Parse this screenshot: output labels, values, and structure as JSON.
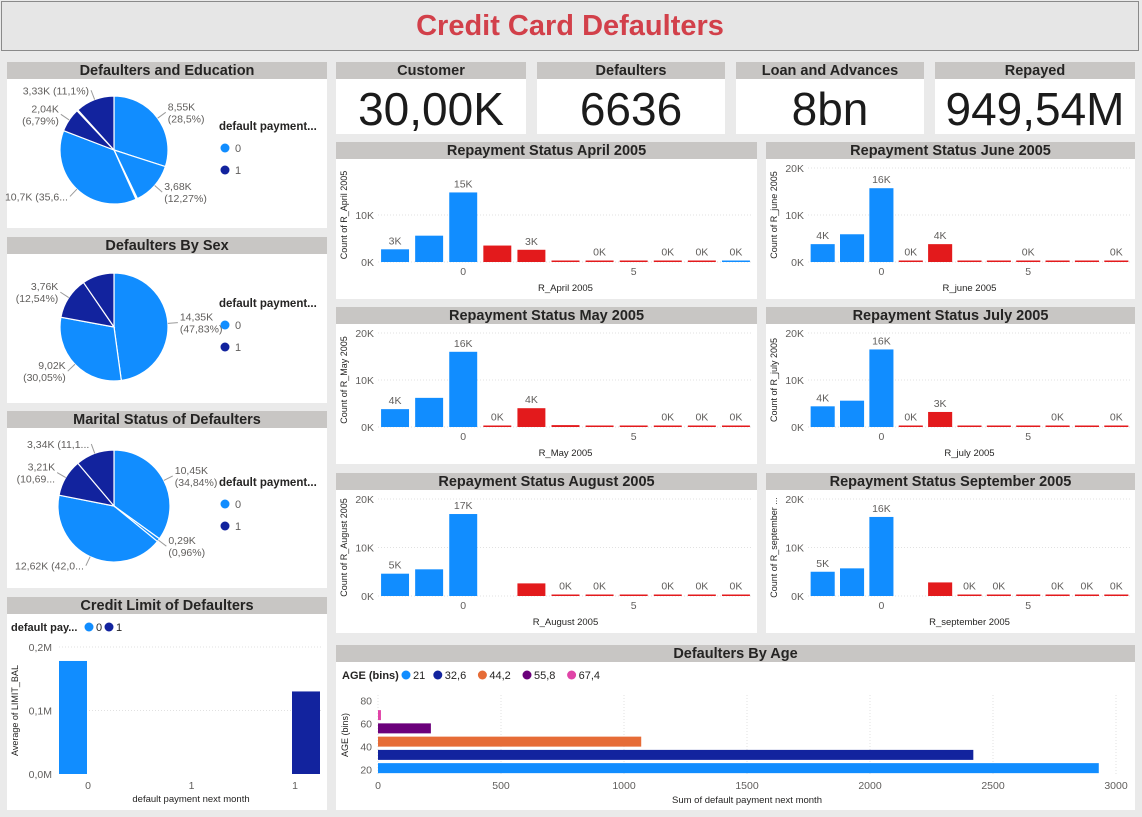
{
  "title": "Credit Card Defaulters",
  "colors": {
    "c0": "#118dff",
    "c1": "#12239e",
    "red": "#e31a1c",
    "age44": "#e66c37",
    "age55": "#6b007b",
    "age67": "#e044a7"
  },
  "kpis": [
    {
      "label": "Customer",
      "value": "30,00K"
    },
    {
      "label": "Defaulters",
      "value": "6636"
    },
    {
      "label": "Loan and Advances",
      "value": "8bn"
    },
    {
      "label": "Repayed",
      "value": "949,54M"
    }
  ],
  "legend": {
    "title": "default payment...",
    "items": [
      "0",
      "1"
    ]
  },
  "chart_data": [
    {
      "id": "education",
      "type": "pie",
      "title": "Defaulters and Education",
      "legend_title": "default payment...",
      "slices": [
        {
          "value": 8.55,
          "label": "8,55K",
          "pct": "(28,5%)",
          "color": "#118dff"
        },
        {
          "value": 3.68,
          "label": "3,68K",
          "pct": "(12,27%)",
          "color": "#118dff"
        },
        {
          "value": 0.06,
          "label": "",
          "pct": "",
          "color": "#118dff"
        },
        {
          "value": 0.07,
          "label": "",
          "pct": "",
          "color": "#118dff"
        },
        {
          "value": 10.7,
          "label": "10,7K (35,6...",
          "pct": "",
          "color": "#118dff"
        },
        {
          "value": 2.04,
          "label": "2,04K",
          "pct": "(6,79%)",
          "color": "#12239e"
        },
        {
          "value": 0.1,
          "label": "",
          "pct": "",
          "color": "#12239e"
        },
        {
          "value": 3.33,
          "label": "3,33K (11,1%)",
          "pct": "",
          "color": "#12239e"
        }
      ]
    },
    {
      "id": "sex",
      "type": "pie",
      "title": "Defaulters By Sex",
      "legend_title": "default payment...",
      "slices": [
        {
          "value": 14.35,
          "label": "14,35K",
          "pct": "(47,83%)",
          "color": "#118dff"
        },
        {
          "value": 9.02,
          "label": "9,02K",
          "pct": "(30,05%)",
          "color": "#118dff"
        },
        {
          "value": 3.76,
          "label": "3,76K",
          "pct": "(12,54%)",
          "color": "#12239e"
        },
        {
          "value": 2.87,
          "label": "",
          "pct": "",
          "color": "#12239e"
        }
      ]
    },
    {
      "id": "marital",
      "type": "pie",
      "title": "Marital Status of Defaulters",
      "legend_title": "default payment...",
      "slices": [
        {
          "value": 10.45,
          "label": "10,45K",
          "pct": "(34,84%)",
          "color": "#118dff"
        },
        {
          "value": 0.29,
          "label": "0,29K",
          "pct": "(0,96%)",
          "color": "#118dff"
        },
        {
          "value": 12.62,
          "label": "12,62K (42,0...",
          "pct": "",
          "color": "#118dff"
        },
        {
          "value": 3.21,
          "label": "3,21K",
          "pct": "(10,69...",
          "color": "#12239e"
        },
        {
          "value": 3.34,
          "label": "3,34K (11,1...",
          "pct": "",
          "color": "#12239e"
        }
      ]
    },
    {
      "id": "april",
      "type": "bar",
      "title": "Repayment Status April 2005",
      "xlabel": "R_April 2005",
      "ylabel": "Count of R_April 2005",
      "ylim": [
        0,
        20000
      ],
      "yticks": [
        "0K",
        "10K"
      ],
      "xticks": [
        0,
        5
      ],
      "values": [
        2700,
        5600,
        14800,
        3500,
        2600,
        300,
        100,
        100,
        100,
        100,
        100
      ],
      "colors": [
        "#118dff",
        "#118dff",
        "#118dff",
        "#e31a1c",
        "#e31a1c",
        "#e31a1c",
        "#e31a1c",
        "#e31a1c",
        "#e31a1c",
        "#e31a1c",
        "#118dff"
      ],
      "labels": [
        "3K",
        "",
        "15K",
        "",
        "3K",
        "",
        "0K",
        "",
        "0K",
        "0K",
        "0K"
      ]
    },
    {
      "id": "june",
      "type": "bar",
      "title": "Repayment Status June 2005",
      "xlabel": "R_june 2005",
      "ylabel": "Count of R_june 2005",
      "ylim": [
        0,
        20000
      ],
      "yticks": [
        "0K",
        "10K",
        "20K"
      ],
      "xticks": [
        0,
        5
      ],
      "values": [
        3800,
        5900,
        15700,
        100,
        3800,
        100,
        100,
        100,
        100,
        100,
        100
      ],
      "colors": [
        "#118dff",
        "#118dff",
        "#118dff",
        "#e31a1c",
        "#e31a1c",
        "#e31a1c",
        "#e31a1c",
        "#e31a1c",
        "#e31a1c",
        "#e31a1c",
        "#e31a1c"
      ],
      "labels": [
        "4K",
        "",
        "16K",
        "0K",
        "4K",
        "",
        "",
        "0K",
        "",
        "",
        "0K"
      ]
    },
    {
      "id": "may",
      "type": "bar",
      "title": "Repayment Status May 2005",
      "xlabel": "R_May 2005",
      "ylabel": "Count of R_May 2005",
      "ylim": [
        0,
        20000
      ],
      "yticks": [
        "0K",
        "10K",
        "20K"
      ],
      "xticks": [
        0,
        5
      ],
      "values": [
        3800,
        6200,
        16000,
        100,
        4000,
        400,
        100,
        100,
        100,
        100,
        100
      ],
      "colors": [
        "#118dff",
        "#118dff",
        "#118dff",
        "#e31a1c",
        "#e31a1c",
        "#e31a1c",
        "#e31a1c",
        "#e31a1c",
        "#e31a1c",
        "#e31a1c",
        "#e31a1c"
      ],
      "labels": [
        "4K",
        "",
        "16K",
        "0K",
        "4K",
        "",
        "",
        "",
        "0K",
        "0K",
        "0K"
      ]
    },
    {
      "id": "july",
      "type": "bar",
      "title": "Repayment Status July 2005",
      "xlabel": "R_july 2005",
      "ylabel": "Count of R_july 2005",
      "ylim": [
        0,
        20000
      ],
      "yticks": [
        "0K",
        "10K",
        "20K"
      ],
      "xticks": [
        0,
        5
      ],
      "values": [
        4400,
        5600,
        16500,
        100,
        3200,
        100,
        100,
        100,
        100,
        100,
        100
      ],
      "colors": [
        "#118dff",
        "#118dff",
        "#118dff",
        "#e31a1c",
        "#e31a1c",
        "#e31a1c",
        "#e31a1c",
        "#e31a1c",
        "#e31a1c",
        "#e31a1c",
        "#e31a1c"
      ],
      "labels": [
        "4K",
        "",
        "16K",
        "0K",
        "3K",
        "",
        "",
        "",
        "0K",
        "",
        "0K"
      ]
    },
    {
      "id": "august",
      "type": "bar",
      "title": "Repayment Status August 2005",
      "xlabel": "R_August 2005",
      "ylabel": "Count of R_August 2005",
      "ylim": [
        0,
        20000
      ],
      "yticks": [
        "0K",
        "10K",
        "20K"
      ],
      "xticks": [
        0,
        5
      ],
      "values": [
        4600,
        5500,
        16900,
        0,
        2600,
        100,
        100,
        100,
        100,
        100,
        100
      ],
      "colors": [
        "#118dff",
        "#118dff",
        "#118dff",
        "#e31a1c",
        "#e31a1c",
        "#e31a1c",
        "#e31a1c",
        "#e31a1c",
        "#e31a1c",
        "#e31a1c",
        "#e31a1c"
      ],
      "labels": [
        "5K",
        "",
        "17K",
        "",
        "",
        "0K",
        "0K",
        "",
        "0K",
        "0K",
        "0K"
      ]
    },
    {
      "id": "september",
      "type": "bar",
      "title": "Repayment Status September 2005",
      "xlabel": "R_september 2005",
      "ylabel": "Count of R_september ...",
      "ylim": [
        0,
        20000
      ],
      "yticks": [
        "0K",
        "10K",
        "20K"
      ],
      "xticks": [
        0,
        5
      ],
      "values": [
        5000,
        5700,
        16300,
        0,
        2800,
        100,
        100,
        100,
        100,
        100,
        100
      ],
      "colors": [
        "#118dff",
        "#118dff",
        "#118dff",
        "#e31a1c",
        "#e31a1c",
        "#e31a1c",
        "#e31a1c",
        "#e31a1c",
        "#e31a1c",
        "#e31a1c",
        "#e31a1c"
      ],
      "labels": [
        "5K",
        "",
        "16K",
        "",
        "",
        "0K",
        "0K",
        "",
        "0K",
        "0K",
        "0K"
      ]
    },
    {
      "id": "credit",
      "type": "bar",
      "title": "Credit Limit of Defaulters",
      "legend_title": "default pay...",
      "legend_items": [
        "0",
        "1"
      ],
      "xlabel": "default payment next month",
      "ylabel": "Average of LIMIT_BAL",
      "xlim": [
        0,
        1
      ],
      "xticks": [
        "0",
        "1",
        "1"
      ],
      "ylim": [
        0,
        0.2
      ],
      "yticks": [
        "0,0M",
        "0,1M",
        "0,2M"
      ],
      "values": [
        0.178,
        0.13
      ],
      "colors": [
        "#118dff",
        "#12239e"
      ]
    },
    {
      "id": "age",
      "type": "bar",
      "orientation": "horizontal",
      "title": "Defaulters By Age",
      "legend_title": "AGE (bins)",
      "legend_items": [
        "21",
        "32,6",
        "44,2",
        "55,8",
        "67,4"
      ],
      "legend_colors": [
        "#118dff",
        "#12239e",
        "#e66c37",
        "#6b007b",
        "#e044a7"
      ],
      "xlabel": "Sum of default payment next month",
      "ylabel": "AGE (bins)",
      "xlim": [
        0,
        3000
      ],
      "xticks": [
        "0",
        "500",
        "1000",
        "1500",
        "2000",
        "2500",
        "3000"
      ],
      "ylim": [
        15,
        85
      ],
      "yticks": [
        "20",
        "40",
        "60",
        "80"
      ],
      "bars": [
        {
          "bin": "21",
          "age": 21,
          "value": 2930,
          "color": "#118dff"
        },
        {
          "bin": "32,6",
          "age": 32.6,
          "value": 2420,
          "color": "#12239e"
        },
        {
          "bin": "44,2",
          "age": 44.2,
          "value": 1070,
          "color": "#e66c37"
        },
        {
          "bin": "55,8",
          "age": 55.8,
          "value": 215,
          "color": "#6b007b"
        },
        {
          "bin": "67,4",
          "age": 67.4,
          "value": 12,
          "color": "#e044a7"
        }
      ]
    }
  ]
}
